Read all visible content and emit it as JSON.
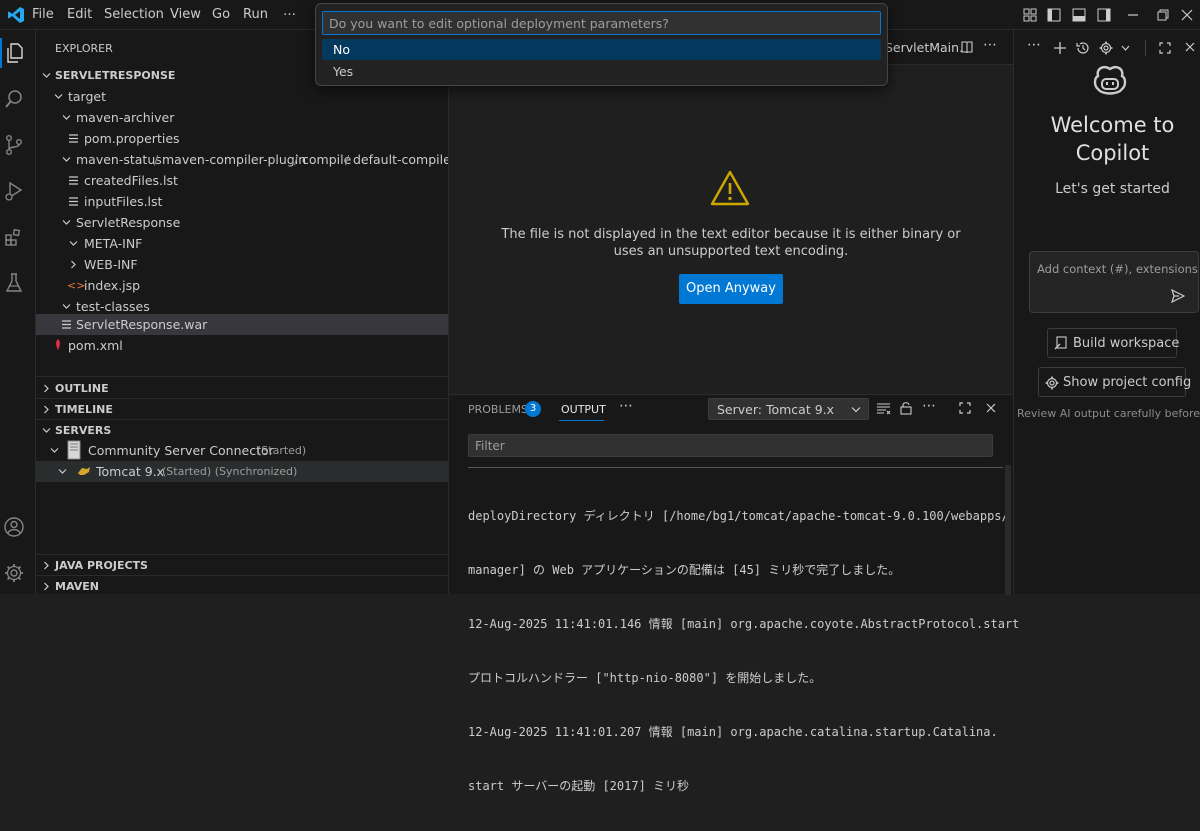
{
  "menu": [
    "File",
    "Edit",
    "Selection",
    "View",
    "Go",
    "Run",
    "…"
  ],
  "quickpick": {
    "placeholder": "Do you want to edit optional deployment parameters?",
    "options": [
      "No",
      "Yes"
    ]
  },
  "explorer": {
    "header": "EXPLORER",
    "root": "SERVLETRESPONSE",
    "tree": {
      "target": "target",
      "maven_archiver": "maven-archiver",
      "pom_properties": "pom.properties",
      "maven_status_path": [
        "maven-status",
        "maven-compiler-plugin",
        "compile",
        "default-compile"
      ],
      "created_files": "createdFiles.lst",
      "input_files": "inputFiles.lst",
      "servlet_response": "ServletResponse",
      "meta_inf": "META-INF",
      "web_inf": "WEB-INF",
      "index_jsp": "index.jsp",
      "test_classes": "test-classes",
      "war": "ServletResponse.war",
      "pom_xml": "pom.xml"
    },
    "sections": {
      "outline": "OUTLINE",
      "timeline": "TIMELINE",
      "servers": "SERVERS",
      "java_projects": "JAVA PROJECTS",
      "maven": "MAVEN"
    },
    "servers": {
      "connector": "Community Server Connector",
      "connector_status": "(Started)",
      "tomcat": "Tomcat 9.x",
      "tomcat_status": "(Started) (Synchronized)"
    }
  },
  "editor": {
    "tab_label": "ServletMain.",
    "message_line1": "The file is not displayed in the text editor because it is either binary or",
    "message_line2": "uses an unsupported text encoding.",
    "open_anyway": "Open Anyway"
  },
  "panel": {
    "problems_label": "PROBLEMS",
    "problems_count": "3",
    "output_label": "OUTPUT",
    "server_select": "Server: Tomcat 9.x",
    "filter_placeholder": "Filter",
    "log_lines": [
      "deployDirectory ディレクトリ [/home/bg1/tomcat/apache-tomcat-9.0.100/webapps/",
      "manager] の Web アプリケーションの配備は [45] ミリ秒で完了しました。",
      "12-Aug-2025 11:41:01.146 情報 [main] org.apache.coyote.AbstractProtocol.start",
      "プロトコルハンドラー [\"http-nio-8080\"] を開始しました。",
      "12-Aug-2025 11:41:01.207 情報 [main] org.apache.catalina.startup.Catalina.",
      "start サーバーの起動 [2017] ミリ秒"
    ]
  },
  "copilot": {
    "welcome_line1": "Welcome to",
    "welcome_line2": "Copilot",
    "subtitle": "Let's get started",
    "input_placeholder": "Add context (#), extensions",
    "build_workspace": "Build workspace",
    "show_project_config": "Show project config",
    "review_note": "Review AI output carefully before use"
  },
  "colors": {
    "accent": "#0078d4",
    "selection": "#04395e",
    "warning": "#cca700",
    "badge": "#0078d4"
  }
}
